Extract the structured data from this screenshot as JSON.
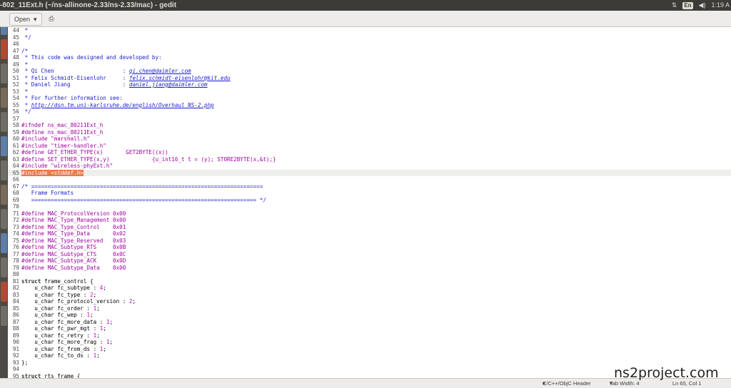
{
  "window": {
    "title": "-802_11Ext.h (~/ns-allinone-2.33/ns-2.33/mac) - gedit",
    "tray_lang": "En",
    "tray_volume": "◀)",
    "tray_time": "1:19 A"
  },
  "toolbar": {
    "open_label": "Open",
    "open_arrow": "▾",
    "save_icon": "⎙"
  },
  "code": {
    "lines": [
      {
        "n": "44",
        "cls": "c",
        "t": " *"
      },
      {
        "n": "45",
        "cls": "c",
        "t": " */"
      },
      {
        "n": "46",
        "cls": "",
        "t": ""
      },
      {
        "n": "47",
        "cls": "c",
        "t": "/*"
      },
      {
        "n": "48",
        "cls": "c",
        "t": " * This code was designed and developed by:"
      },
      {
        "n": "49",
        "cls": "c",
        "t": " *"
      },
      {
        "n": "50",
        "cls": "c",
        "t": " * Qi Chen                     : ",
        "link": "qi.chen@daimler.com"
      },
      {
        "n": "51",
        "cls": "c",
        "t": " * Felix Schmidt-Eisenlohr     : ",
        "link": "felix.schmidt-eisenlohr@kit.edu"
      },
      {
        "n": "52",
        "cls": "c",
        "t": " * Daniel Jiang                : ",
        "link": "daniel.jiang@daimler.com"
      },
      {
        "n": "53",
        "cls": "c",
        "t": " *"
      },
      {
        "n": "54",
        "cls": "c",
        "t": " * For further information see:"
      },
      {
        "n": "55",
        "cls": "c",
        "t": " * ",
        "link": "http://dsn.tm.uni-karlsruhe.de/english/Overhaul_NS-2.php"
      },
      {
        "n": "56",
        "cls": "c",
        "t": " */"
      },
      {
        "n": "57",
        "cls": "",
        "t": ""
      },
      {
        "n": "58",
        "cls": "pp",
        "t": "#ifndef ns_mac_80211Ext_h"
      },
      {
        "n": "59",
        "cls": "pp",
        "t": "#define ns_mac_80211Ext_h"
      },
      {
        "n": "60",
        "cls": "pp",
        "t": "#include \"marshall.h\""
      },
      {
        "n": "61",
        "cls": "pp",
        "t": "#include \"timer-handler.h\""
      },
      {
        "n": "62",
        "cls": "pp",
        "t": "#define GET_ETHER_TYPE(x)       GET2BYTE((x))"
      },
      {
        "n": "63",
        "cls": "pp",
        "t": "#define SET_ETHER_TYPE(x,y)             {u_int16_t t = (y); STORE2BYTE(x,&t);}"
      },
      {
        "n": "64",
        "cls": "pp",
        "t": "#include \"wireless-phyExt.h\""
      },
      {
        "n": "65",
        "cls": "sel",
        "t": "#include <stddef.h>",
        "cur": true
      },
      {
        "n": "66",
        "cls": "",
        "t": ""
      },
      {
        "n": "67",
        "cls": "c",
        "t": "/* ======================================================================="
      },
      {
        "n": "68",
        "cls": "c",
        "t": "   Frame Formats"
      },
      {
        "n": "69",
        "cls": "c",
        "t": "   ===================================================================== */"
      },
      {
        "n": "70",
        "cls": "",
        "t": ""
      },
      {
        "n": "71",
        "cls": "pp",
        "t": "#define MAC_ProtocolVersion 0x00"
      },
      {
        "n": "72",
        "cls": "pp",
        "t": "#define MAC_Type_Management 0x00"
      },
      {
        "n": "73",
        "cls": "pp",
        "t": "#define MAC_Type_Control    0x01"
      },
      {
        "n": "74",
        "cls": "pp",
        "t": "#define MAC_Type_Data       0x02"
      },
      {
        "n": "75",
        "cls": "pp",
        "t": "#define MAC_Type_Reserved   0x03"
      },
      {
        "n": "76",
        "cls": "pp",
        "t": "#define MAC_Subtype_RTS     0x0B"
      },
      {
        "n": "77",
        "cls": "pp",
        "t": "#define MAC_Subtype_CTS     0x0C"
      },
      {
        "n": "78",
        "cls": "pp",
        "t": "#define MAC_Subtype_ACK     0x0D"
      },
      {
        "n": "79",
        "cls": "pp",
        "t": "#define MAC_Subtype_Data    0x00"
      },
      {
        "n": "80",
        "cls": "",
        "t": ""
      },
      {
        "n": "81",
        "cls": "",
        "t": "struct frame_control {",
        "kw": "struct"
      },
      {
        "n": "82",
        "cls": "",
        "t": "    u_char fc_subtype : ",
        "num": "4",
        "tail": ";"
      },
      {
        "n": "83",
        "cls": "",
        "t": "    u_char fc_type : ",
        "num": "2",
        "tail": ";"
      },
      {
        "n": "84",
        "cls": "",
        "t": "    u_char fc_protocol_version : ",
        "num": "2",
        "tail": ";"
      },
      {
        "n": "85",
        "cls": "",
        "t": "    u_char fc_order : ",
        "num": "1",
        "tail": ";"
      },
      {
        "n": "86",
        "cls": "",
        "t": "    u_char fc_wep : ",
        "num": "1",
        "tail": ";"
      },
      {
        "n": "87",
        "cls": "",
        "t": "    u_char fc_more_data : ",
        "num": "1",
        "tail": ";"
      },
      {
        "n": "88",
        "cls": "",
        "t": "    u_char fc_pwr_mgt : ",
        "num": "1",
        "tail": ";"
      },
      {
        "n": "89",
        "cls": "",
        "t": "    u_char fc_retry : ",
        "num": "1",
        "tail": ";"
      },
      {
        "n": "90",
        "cls": "",
        "t": "    u_char fc_more_frag : ",
        "num": "1",
        "tail": ";"
      },
      {
        "n": "91",
        "cls": "",
        "t": "    u_char fc_from_ds : ",
        "num": "1",
        "tail": ";"
      },
      {
        "n": "92",
        "cls": "",
        "t": "    u_char fc_to_ds : ",
        "num": "1",
        "tail": ";"
      },
      {
        "n": "93",
        "cls": "",
        "t": "};"
      },
      {
        "n": "94",
        "cls": "",
        "t": ""
      },
      {
        "n": "95",
        "cls": "",
        "t": "struct rts_frame {",
        "kw": "struct"
      }
    ]
  },
  "statusbar": {
    "language": "C/C++/ObjC Header",
    "language_arrow": "▾",
    "tab_width": "Tab Width: 4",
    "tab_arrow": "▾",
    "position": "Ln 65, Col 1"
  },
  "watermark": "ns2project.com"
}
